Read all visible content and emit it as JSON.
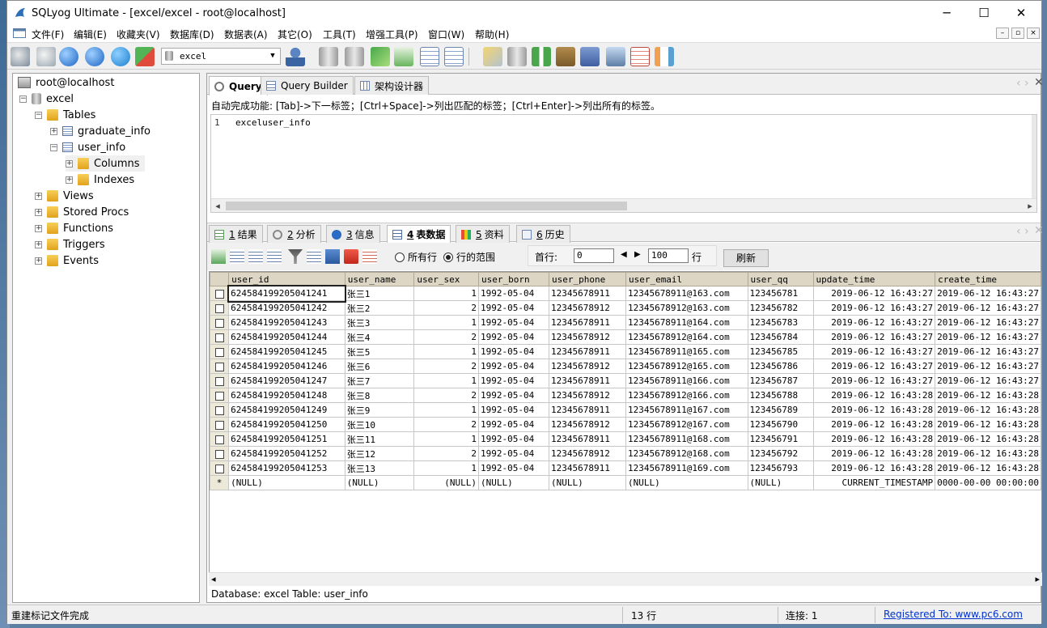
{
  "window": {
    "title": "SQLyog Ultimate - [excel/excel - root@localhost]",
    "minimize": "─",
    "maximize": "☐",
    "close": "✕"
  },
  "menu": [
    "文件(F)",
    "编辑(E)",
    "收藏夹(V)",
    "数据库(D)",
    "数据表(A)",
    "其它(O)",
    "工具(T)",
    "增强工具(P)",
    "窗口(W)",
    "帮助(H)"
  ],
  "toolbar": {
    "database": "excel"
  },
  "tree": {
    "root": "root@localhost",
    "database": "excel",
    "tables_label": "Tables",
    "tables": [
      "graduate_info",
      "user_info"
    ],
    "columns_label": "Columns",
    "indexes_label": "Indexes",
    "views": "Views",
    "procs": "Stored Procs",
    "functions": "Functions",
    "triggers": "Triggers",
    "events": "Events"
  },
  "query_tabs": [
    "Query",
    "Query Builder",
    "架构设计器"
  ],
  "hint": "自动完成功能: [Tab]->下一标签；[Ctrl+Space]->列出匹配的标签；[Ctrl+Enter]->列出所有的标签。",
  "editor": {
    "line": "1",
    "code": "exceluser_info"
  },
  "result_tabs": [
    {
      "num": "1",
      "label": "结果"
    },
    {
      "num": "2",
      "label": "分析"
    },
    {
      "num": "3",
      "label": "信息"
    },
    {
      "num": "4",
      "label": "表数据"
    },
    {
      "num": "5",
      "label": "资料"
    },
    {
      "num": "6",
      "label": "历史"
    }
  ],
  "gridbar": {
    "all_rows": "所有行",
    "range": "行的范围",
    "first_row_label": "首行:",
    "first_row": "0",
    "count": "100",
    "rows_label": "行",
    "refresh": "刷新"
  },
  "columns": [
    "user_id",
    "user_name",
    "user_sex",
    "user_born",
    "user_phone",
    "user_email",
    "user_qq",
    "update_time",
    "create_time"
  ],
  "rows": [
    [
      "624584199205041241",
      "张三1",
      "1",
      "1992-05-04",
      "12345678911",
      "12345678911@163.com",
      "123456781",
      "2019-06-12 16:43:27",
      "2019-06-12 16:43:27"
    ],
    [
      "624584199205041242",
      "张三2",
      "2",
      "1992-05-04",
      "12345678912",
      "12345678912@163.com",
      "123456782",
      "2019-06-12 16:43:27",
      "2019-06-12 16:43:27"
    ],
    [
      "624584199205041243",
      "张三3",
      "1",
      "1992-05-04",
      "12345678911",
      "12345678911@164.com",
      "123456783",
      "2019-06-12 16:43:27",
      "2019-06-12 16:43:27"
    ],
    [
      "624584199205041244",
      "张三4",
      "2",
      "1992-05-04",
      "12345678912",
      "12345678912@164.com",
      "123456784",
      "2019-06-12 16:43:27",
      "2019-06-12 16:43:27"
    ],
    [
      "624584199205041245",
      "张三5",
      "1",
      "1992-05-04",
      "12345678911",
      "12345678911@165.com",
      "123456785",
      "2019-06-12 16:43:27",
      "2019-06-12 16:43:27"
    ],
    [
      "624584199205041246",
      "张三6",
      "2",
      "1992-05-04",
      "12345678912",
      "12345678912@165.com",
      "123456786",
      "2019-06-12 16:43:27",
      "2019-06-12 16:43:27"
    ],
    [
      "624584199205041247",
      "张三7",
      "1",
      "1992-05-04",
      "12345678911",
      "12345678911@166.com",
      "123456787",
      "2019-06-12 16:43:27",
      "2019-06-12 16:43:27"
    ],
    [
      "624584199205041248",
      "张三8",
      "2",
      "1992-05-04",
      "12345678912",
      "12345678912@166.com",
      "123456788",
      "2019-06-12 16:43:28",
      "2019-06-12 16:43:28"
    ],
    [
      "624584199205041249",
      "张三9",
      "1",
      "1992-05-04",
      "12345678911",
      "12345678911@167.com",
      "123456789",
      "2019-06-12 16:43:28",
      "2019-06-12 16:43:28"
    ],
    [
      "624584199205041250",
      "张三10",
      "2",
      "1992-05-04",
      "12345678912",
      "12345678912@167.com",
      "123456790",
      "2019-06-12 16:43:28",
      "2019-06-12 16:43:28"
    ],
    [
      "624584199205041251",
      "张三11",
      "1",
      "1992-05-04",
      "12345678911",
      "12345678911@168.com",
      "123456791",
      "2019-06-12 16:43:28",
      "2019-06-12 16:43:28"
    ],
    [
      "624584199205041252",
      "张三12",
      "2",
      "1992-05-04",
      "12345678912",
      "12345678912@168.com",
      "123456792",
      "2019-06-12 16:43:28",
      "2019-06-12 16:43:28"
    ],
    [
      "624584199205041253",
      "张三13",
      "1",
      "1992-05-04",
      "12345678911",
      "12345678911@169.com",
      "123456793",
      "2019-06-12 16:43:28",
      "2019-06-12 16:43:28"
    ]
  ],
  "new_row": [
    "(NULL)",
    "(NULL)",
    "(NULL)",
    "(NULL)",
    "(NULL)",
    "(NULL)",
    "(NULL)",
    "CURRENT_TIMESTAMP",
    "0000-00-00 00:00:00"
  ],
  "new_row_marker": "*",
  "info_line": "Database: excel Table: user_info",
  "status": {
    "message": "重建标记文件完成",
    "rows": "13 行",
    "connection": "连接: 1",
    "registered": "Registered To: www.pc6.com"
  }
}
